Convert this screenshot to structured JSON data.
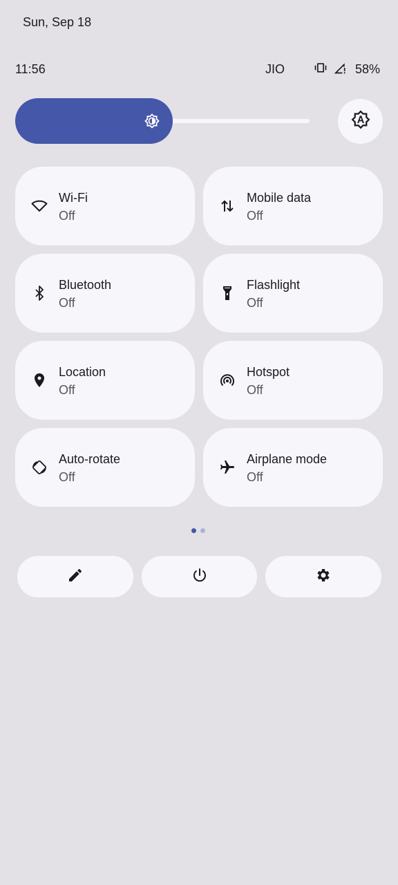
{
  "date": "Sun, Sep 18",
  "status": {
    "time": "11:56",
    "carrier": "JIO",
    "battery": "58%",
    "icons": [
      "vibrate-icon",
      "signal-icon"
    ]
  },
  "brightness": {
    "level": 0.5,
    "accent": "#4557a8",
    "icon": "brightness-icon",
    "auto_icon": "auto-brightness-icon"
  },
  "tiles": [
    {
      "label": "Wi-Fi",
      "state": "Off",
      "icon": "wifi-icon"
    },
    {
      "label": "Mobile data",
      "state": "Off",
      "icon": "mobile-data-icon"
    },
    {
      "label": "Bluetooth",
      "state": "Off",
      "icon": "bluetooth-icon"
    },
    {
      "label": "Flashlight",
      "state": "Off",
      "icon": "flashlight-icon"
    },
    {
      "label": "Location",
      "state": "Off",
      "icon": "location-icon"
    },
    {
      "label": "Hotspot",
      "state": "Off",
      "icon": "hotspot-icon"
    },
    {
      "label": "Auto-rotate",
      "state": "Off",
      "icon": "auto-rotate-icon"
    },
    {
      "label": "Airplane mode",
      "state": "Off",
      "icon": "airplane-icon"
    }
  ],
  "pager": {
    "pages": 2,
    "current": 1,
    "active_color": "#4557a8",
    "inactive_color": "#a9b3d6"
  },
  "bottom_buttons": [
    {
      "icon": "edit-icon"
    },
    {
      "icon": "power-icon"
    },
    {
      "icon": "settings-icon"
    }
  ],
  "colors": {
    "background": "#e3e1e6",
    "tile": "#f7f6fb"
  }
}
